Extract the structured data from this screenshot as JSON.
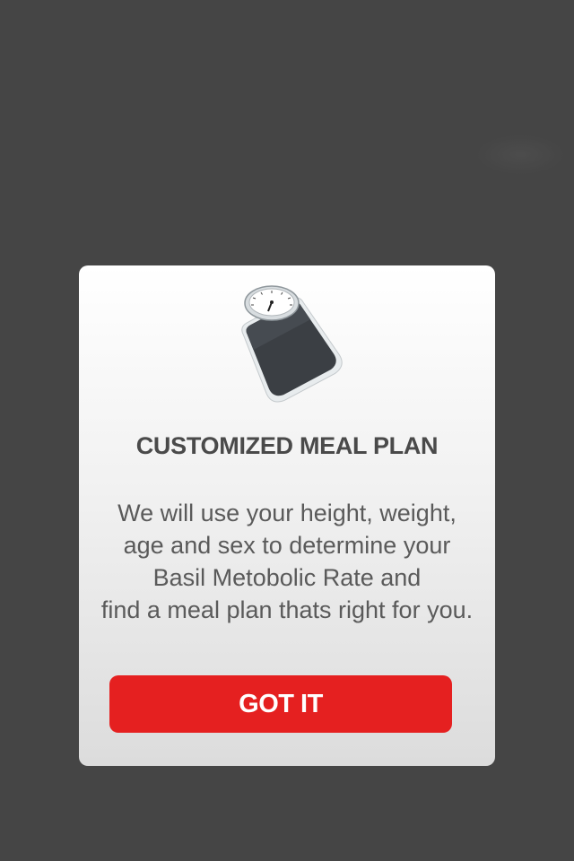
{
  "dialog": {
    "icon": "bathroom-scale-icon",
    "title": "CUSTOMIZED MEAL PLAN",
    "body_lines": [
      "We will use your height, weight,",
      "age and sex to determine your",
      "Basil Metobolic Rate and",
      "find a meal plan thats right for you."
    ],
    "button_label": "GOT IT"
  },
  "colors": {
    "background": "#454545",
    "button": "#e52020",
    "title": "#4a4a4a",
    "body": "#5a5a5a"
  }
}
